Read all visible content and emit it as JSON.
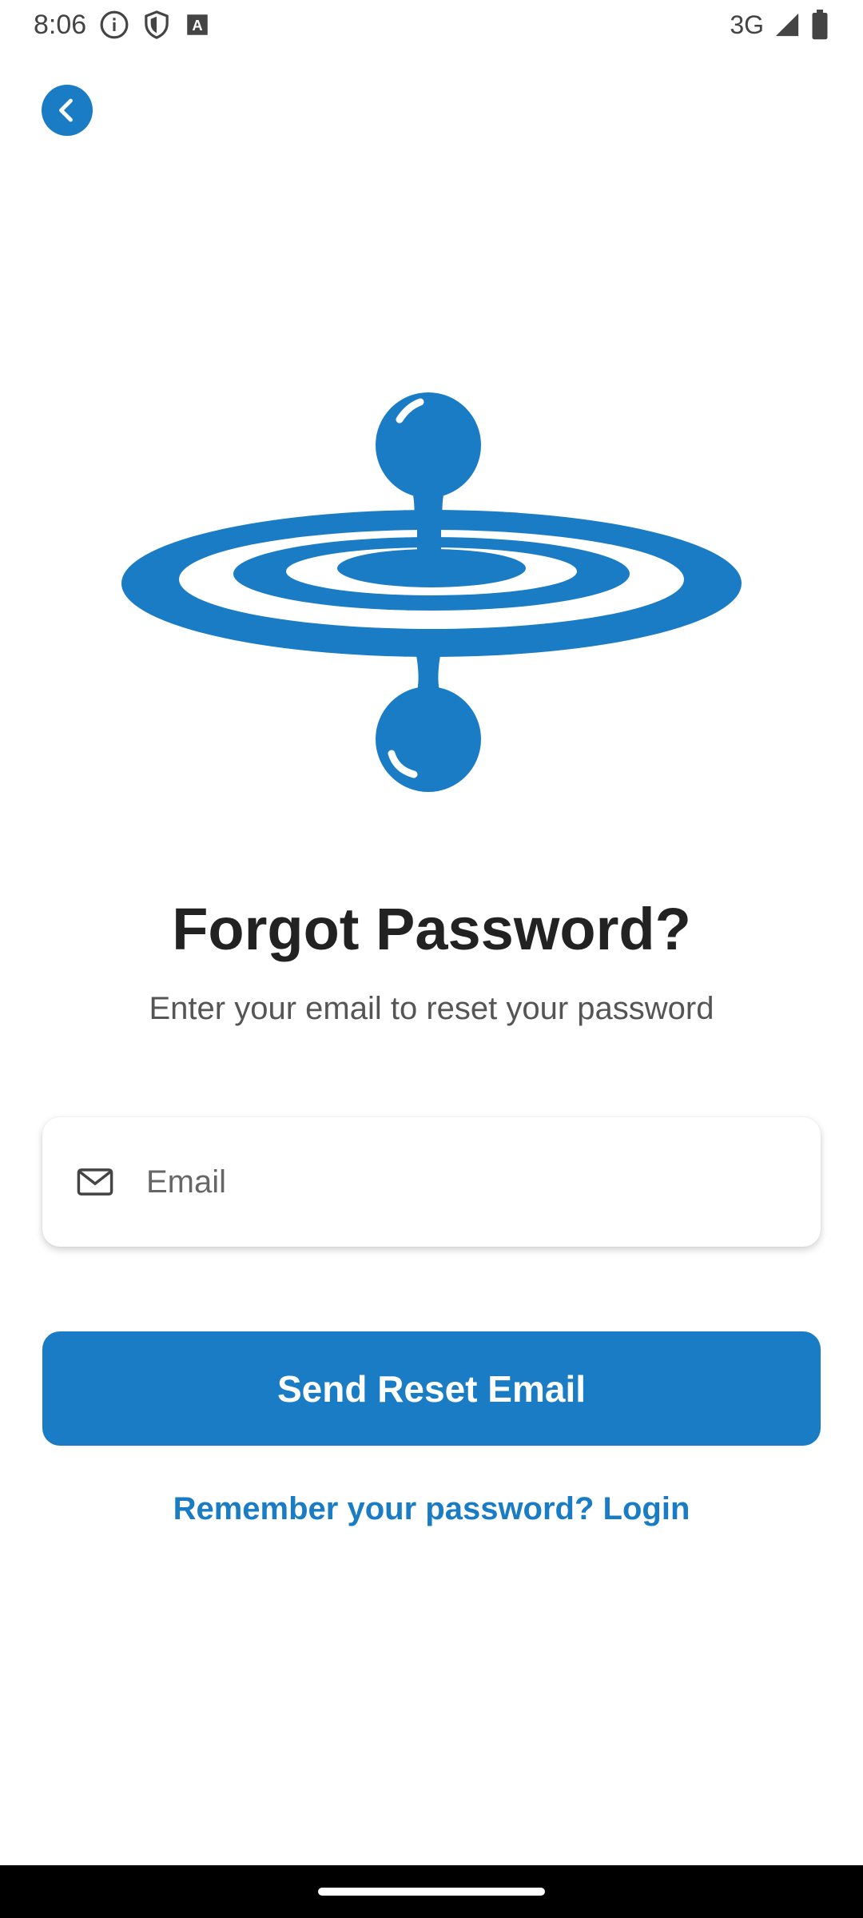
{
  "status_bar": {
    "time": "8:06",
    "network": "3G",
    "icons": [
      "info-icon",
      "shield-icon",
      "keyboard-a-icon",
      "signal-icon",
      "battery-icon"
    ]
  },
  "header": {
    "back_icon": "chevron-left-icon"
  },
  "logo": {
    "name": "water-drop-ripple-logo",
    "color": "#1a7cc4"
  },
  "main": {
    "title": "Forgot Password?",
    "subtitle": "Enter your email to reset your password",
    "email": {
      "placeholder": "Email",
      "value": "",
      "icon": "mail-icon"
    },
    "send_button_label": "Send Reset Email",
    "login_link": "Remember your password? Login"
  },
  "colors": {
    "accent": "#1a7cc4",
    "title": "#222222",
    "subtitle": "#555555"
  }
}
